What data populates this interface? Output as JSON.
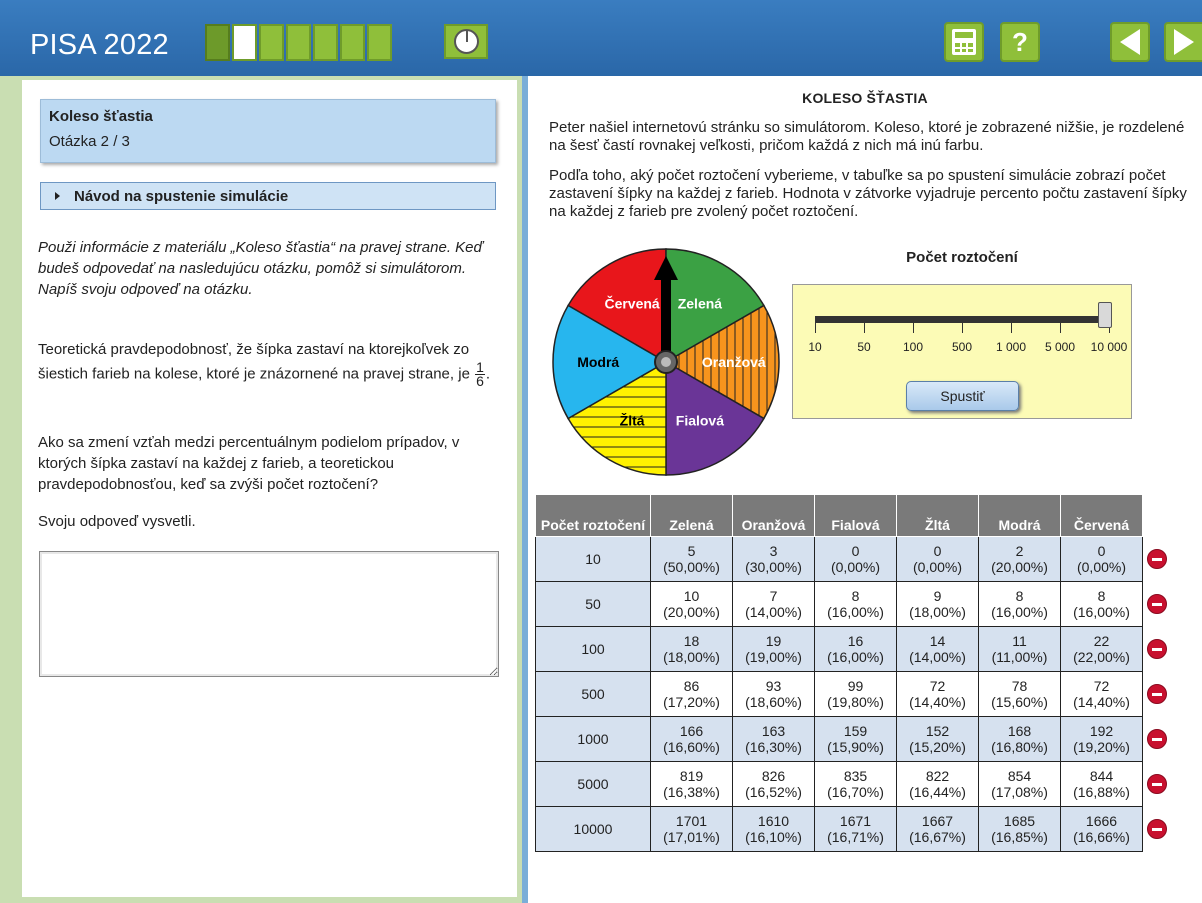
{
  "app": {
    "title": "PISA 2022",
    "progress": {
      "total": 8,
      "completed": 1,
      "current": 2
    }
  },
  "toolbar": {
    "timer_icon": "timer-icon",
    "calculator_icon": "calculator-icon",
    "help_label": "?",
    "back_icon": "arrow-left-icon",
    "next_icon": "arrow-right-icon"
  },
  "left": {
    "question_title": "Koleso šťastia",
    "question_count": "Otázka 2 / 3",
    "sim_guide_label": "Návod na spustenie simulácie",
    "intro_text": "Použi informácie z materiálu „Koleso šťastia“ na pravej strane. Keď budeš odpovedať na nasledujúcu otázku, pomôž si simulátorom. Napíš svoju odpoveď na otázku.",
    "prob_text": "Teoretická pravdepodobnosť, že šípka zastaví na ktorejkoľvek zo šiestich farieb na kolese, ktoré je znázornené na pravej strane, je",
    "prob_num": "1",
    "prob_den": "6",
    "prob_end": ".",
    "question_text": "Ako sa zmení vzťah medzi percentuálnym podielom prípadov, v ktorých šípka zastaví na každej z farieb, a teoretickou pravdepodobnosťou, keď sa zvýši počet roztočení?",
    "explain_text": "Svoju odpoveď vysvetli.",
    "answer_value": ""
  },
  "right": {
    "title": "KOLESO ŠŤASTIA",
    "p1": "Peter našiel internetovú stránku so simulátorom. Koleso, ktoré je zobrazené nižšie, je rozdelené na šesť častí rovnakej veľkosti, pričom každá z nich má inú farbu.",
    "p2": "Podľa toho, aký počet roztočení vyberieme, v tabuľke sa po spustení simulácie zobrazí počet zastavení šípky na každej z farieb. Hodnota v zátvorke vyjadruje percento počtu zastavení šípky na každej z farieb pre zvolený počet roztočení.",
    "wheel": {
      "segments": [
        {
          "label": "Červená",
          "color": "#e8161b"
        },
        {
          "label": "Zelená",
          "color": "#3ba144"
        },
        {
          "label": "Oranžová",
          "color": "#f7941d"
        },
        {
          "label": "Fialová",
          "color": "#6a3597"
        },
        {
          "label": "Žltá",
          "color": "#fff200"
        },
        {
          "label": "Modrá",
          "color": "#27b6ee"
        }
      ]
    },
    "spins_title": "Počet roztočení",
    "slider": {
      "ticks": [
        "10",
        "50",
        "100",
        "500",
        "1 000",
        "5 000",
        "10 000"
      ],
      "selected_index": 6
    },
    "run_label": "Spustiť",
    "table": {
      "headers": [
        "Počet roztočení",
        "Zelená",
        "Oranžová",
        "Fialová",
        "Žltá",
        "Modrá",
        "Červená"
      ],
      "rows": [
        {
          "spins": "10",
          "cells": [
            [
              "5",
              "(50,00%)"
            ],
            [
              "3",
              "(30,00%)"
            ],
            [
              "0",
              "(0,00%)"
            ],
            [
              "0",
              "(0,00%)"
            ],
            [
              "2",
              "(20,00%)"
            ],
            [
              "0",
              "(0,00%)"
            ]
          ]
        },
        {
          "spins": "50",
          "cells": [
            [
              "10",
              "(20,00%)"
            ],
            [
              "7",
              "(14,00%)"
            ],
            [
              "8",
              "(16,00%)"
            ],
            [
              "9",
              "(18,00%)"
            ],
            [
              "8",
              "(16,00%)"
            ],
            [
              "8",
              "(16,00%)"
            ]
          ]
        },
        {
          "spins": "100",
          "cells": [
            [
              "18",
              "(18,00%)"
            ],
            [
              "19",
              "(19,00%)"
            ],
            [
              "16",
              "(16,00%)"
            ],
            [
              "14",
              "(14,00%)"
            ],
            [
              "11",
              "(11,00%)"
            ],
            [
              "22",
              "(22,00%)"
            ]
          ]
        },
        {
          "spins": "500",
          "cells": [
            [
              "86",
              "(17,20%)"
            ],
            [
              "93",
              "(18,60%)"
            ],
            [
              "99",
              "(19,80%)"
            ],
            [
              "72",
              "(14,40%)"
            ],
            [
              "78",
              "(15,60%)"
            ],
            [
              "72",
              "(14,40%)"
            ]
          ]
        },
        {
          "spins": "1000",
          "cells": [
            [
              "166",
              "(16,60%)"
            ],
            [
              "163",
              "(16,30%)"
            ],
            [
              "159",
              "(15,90%)"
            ],
            [
              "152",
              "(15,20%)"
            ],
            [
              "168",
              "(16,80%)"
            ],
            [
              "192",
              "(19,20%)"
            ]
          ]
        },
        {
          "spins": "5000",
          "cells": [
            [
              "819",
              "(16,38%)"
            ],
            [
              "826",
              "(16,52%)"
            ],
            [
              "835",
              "(16,70%)"
            ],
            [
              "822",
              "(16,44%)"
            ],
            [
              "854",
              "(17,08%)"
            ],
            [
              "844",
              "(16,88%)"
            ]
          ]
        },
        {
          "spins": "10000",
          "cells": [
            [
              "1701",
              "(17,01%)"
            ],
            [
              "1610",
              "(16,10%)"
            ],
            [
              "1671",
              "(16,71%)"
            ],
            [
              "1667",
              "(16,67%)"
            ],
            [
              "1685",
              "(16,85%)"
            ],
            [
              "1666",
              "(16,66%)"
            ]
          ]
        }
      ]
    }
  }
}
